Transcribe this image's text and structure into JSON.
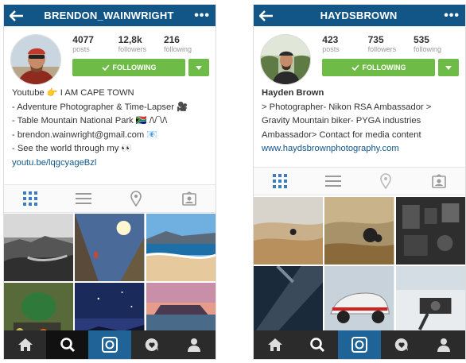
{
  "left": {
    "username": "BRENDON_WAINWRIGHT",
    "stats": [
      {
        "num": "4077",
        "label": "posts"
      },
      {
        "num": "12,8k",
        "label": "followers"
      },
      {
        "num": "216",
        "label": "following"
      }
    ],
    "follow_label": "FOLLOWING",
    "bio": [
      "Youtube 👉 I AM CAPE TOWN",
      "- Adventure Photographer & Time-Lapser 🎥",
      "- Table Mountain National Park 🇿🇦 /\\/‾\\/\\",
      "- brendon.wainwright@gmail.com 📧",
      "- See the world through my 👀"
    ],
    "link": "youtu.be/lqgcyageBzl"
  },
  "right": {
    "username": "HAYDSBROWN",
    "stats": [
      {
        "num": "423",
        "label": "posts"
      },
      {
        "num": "735",
        "label": "followers"
      },
      {
        "num": "535",
        "label": "following"
      }
    ],
    "follow_label": "FOLLOWING",
    "name": "Hayden Brown",
    "bio": [
      "> Photographer- Nikon RSA Ambassador >",
      "Gravity Mountain biker- PYGA industries",
      "Ambassador> Contact for media content"
    ],
    "link": "www.haydsbrownphotography.com"
  },
  "icons": {
    "back": "back-arrow-icon",
    "more": "more-dots-icon",
    "check": "check-icon",
    "caret": "caret-down-icon",
    "tabs": [
      "grid-view-icon",
      "list-view-icon",
      "map-pin-icon",
      "tagged-photos-icon"
    ],
    "nav": [
      "home-icon",
      "search-icon",
      "camera-icon",
      "activity-icon",
      "profile-icon"
    ]
  },
  "colors": {
    "header": "#125688",
    "follow": "#6fbb47",
    "nav": "#2b2b2b",
    "nav_active": "#1f6397",
    "link": "#125688"
  }
}
